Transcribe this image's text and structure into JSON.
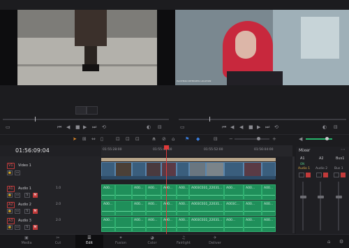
{
  "timecode": "01:56:09:04",
  "ruler": {
    "ticks": [
      "01:55:28:00",
      "01:55:40:00",
      "01:55:52:00",
      "01:56:04:00"
    ]
  },
  "viewer": {
    "caption": "PLAYHEAD INTERVIEW LOCATION"
  },
  "tracks": {
    "video": [
      {
        "id": "V1",
        "name": "Video 1"
      }
    ],
    "audio": [
      {
        "id": "A1",
        "name": "Audio 1",
        "level": "1.0"
      },
      {
        "id": "A2",
        "name": "Audio 2",
        "level": "2.0"
      },
      {
        "id": "A3",
        "name": "Audio 3",
        "level": "2.0"
      }
    ],
    "buttons": {
      "solo": "S",
      "mute": "M"
    }
  },
  "clips": {
    "audio_long": "A003C031_22031...",
    "audio_short": "A00...",
    "audio_mid": "A003C..."
  },
  "mixer": {
    "title": "Mixer",
    "channels": [
      "A1",
      "A2",
      "Bus1"
    ],
    "channel_names": [
      "Audio 1",
      "Audio 2",
      "Bus 1"
    ],
    "row_label": "ON"
  },
  "page_nav": [
    {
      "label": "Media",
      "icon": "media-icon"
    },
    {
      "label": "Cut",
      "icon": "cut-icon"
    },
    {
      "label": "Edit",
      "icon": "edit-icon",
      "active": true
    },
    {
      "label": "Fusion",
      "icon": "fusion-icon"
    },
    {
      "label": "Color",
      "icon": "color-icon"
    },
    {
      "label": "Fairlight",
      "icon": "fairlight-icon"
    },
    {
      "label": "Deliver",
      "icon": "deliver-icon"
    }
  ],
  "colors": {
    "playhead": "#e03a3a",
    "video_clip": "#3a5e7d",
    "audio_clip": "#1f8f5a",
    "accent": "#e08a2a"
  }
}
